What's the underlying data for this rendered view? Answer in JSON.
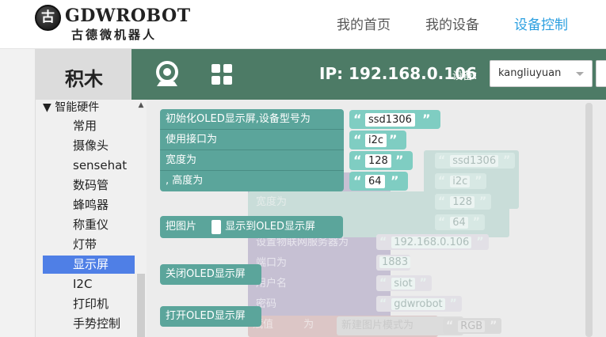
{
  "header": {
    "logo_en": "GDWROBOT",
    "logo_cn": "古德微机器人",
    "logo_mark": "古",
    "nav": [
      {
        "label": "我的首页",
        "active": false
      },
      {
        "label": "我的设备",
        "active": false
      },
      {
        "label": "设备控制",
        "active": true
      }
    ]
  },
  "sidebar": {
    "title": "积木",
    "group": "▼ 智能硬件",
    "items": [
      "常用",
      "摄像头",
      "sensehat",
      "数码管",
      "蜂鸣器",
      "称重仪",
      "灯带",
      "显示屏",
      "I2C",
      "打印机",
      "手势控制"
    ],
    "selected": "显示屏"
  },
  "toolbar": {
    "camera_icon": "camera-icon",
    "grid_icon": "grid-icon",
    "ip": "IP: 192.168.0.106",
    "device_label": "设备：",
    "device_value": "kangliuyuan"
  },
  "blocks": {
    "init_oled": {
      "row1": "初始化OLED显示屏,设备型号为",
      "row2": "使用接口为",
      "row3": "宽度为",
      "row4": ", 高度为",
      "model": "ssd1306",
      "iface": "i2c",
      "width": "128",
      "height": "64"
    },
    "show_image": {
      "prefix": "把图片",
      "suffix": "显示到OLED显示屏"
    },
    "close_oled": "关闭OLED显示屏",
    "open_oled": "打开OLED显示屏"
  },
  "ghost": {
    "width_label": "宽度为",
    "server_label": "设置物联网服务器为",
    "port_label": "端口为",
    "user_label": "用户名",
    "pass_label": "密码",
    "assign_label": "赋值",
    "assign_as": "为",
    "new_image_label": "新建图片模式为",
    "model": "ssd1306",
    "iface": "i2c",
    "width": "128",
    "height": "64",
    "server_ip": "192.168.0.106",
    "port": "1883",
    "user": "siot",
    "password": "gdwrobot",
    "mode": "RGB"
  },
  "colors": {
    "toolbar": "#4d7b66",
    "block": "#5ba59b",
    "string_block": "#7fcdc2",
    "selected_item": "#4f7fe6",
    "nav_active": "#2b9fe0"
  }
}
